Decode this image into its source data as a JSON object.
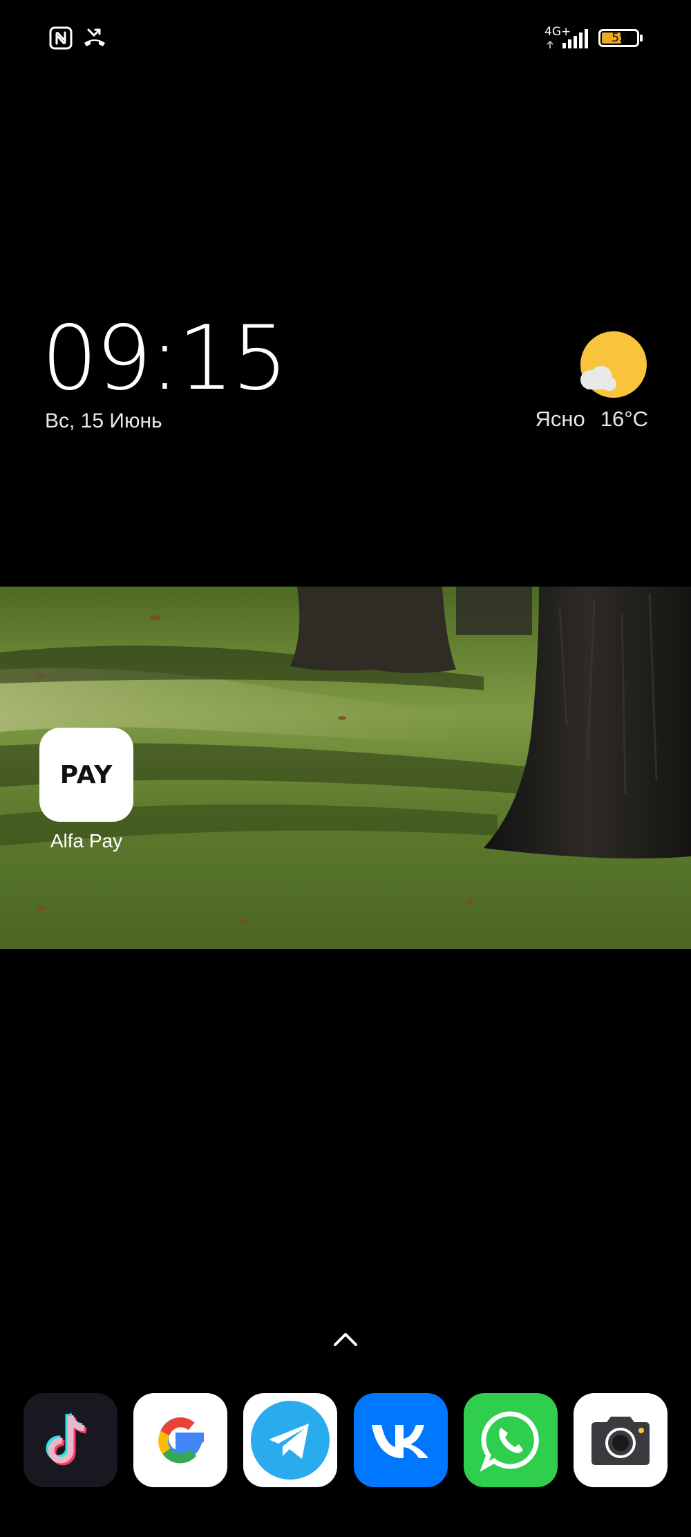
{
  "status_bar": {
    "left_icons": [
      "nfc-icon",
      "missed-call-icon"
    ],
    "network": "4G+",
    "signal_bars": 4,
    "battery_level": "55",
    "battery_fill": 0.55
  },
  "clock_widget": {
    "time": "09:15",
    "date": "Вс, 15 Июнь"
  },
  "weather_widget": {
    "condition": "Ясно",
    "temperature": "16°C",
    "icon": "sun-cloud-icon"
  },
  "home_apps": [
    {
      "label": "Alfa Pay",
      "tile_text": "PAY",
      "icon": "alfa-pay-icon"
    }
  ],
  "app_drawer": {
    "icon": "chevron-up-icon"
  },
  "dock": {
    "apps": [
      {
        "icon": "tiktok-icon"
      },
      {
        "icon": "google-icon"
      },
      {
        "icon": "telegram-icon"
      },
      {
        "icon": "vk-icon"
      },
      {
        "icon": "whatsapp-icon"
      },
      {
        "icon": "camera-icon"
      }
    ]
  },
  "colors": {
    "background": "#000000",
    "sun": "#F9C33C",
    "battery_fill": "#E9A923",
    "grass": "#5E7A2E",
    "vk_blue": "#0077FF",
    "whatsapp_green": "#2FCF4D",
    "telegram_blue": "#2AABEE"
  }
}
